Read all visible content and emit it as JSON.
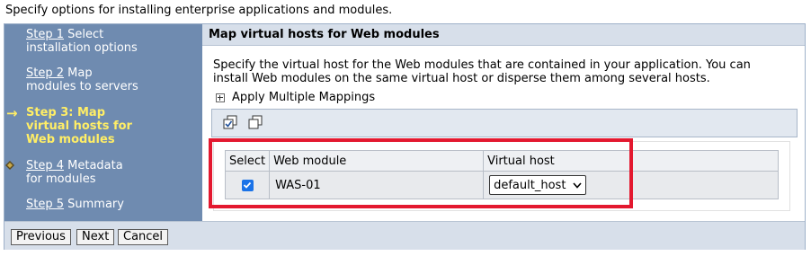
{
  "intro": "Specify options for installing enterprise applications and modules.",
  "steps": {
    "step1": {
      "link": "Step 1",
      "text": " Select",
      "line2": "installation options"
    },
    "step2": {
      "link": "Step 2",
      "text": " Map",
      "line2": "modules to servers"
    },
    "step3": {
      "line1": "Step 3: Map",
      "line2": "virtual hosts for",
      "line3": "Web modules"
    },
    "step4": {
      "link": "Step 4",
      "text": " Metadata",
      "line2": "for modules"
    },
    "step5": {
      "link": "Step 5",
      "text": " Summary"
    }
  },
  "content": {
    "title": "Map virtual hosts for Web modules",
    "description": "Specify the virtual host for the Web modules that are contained in your application. You can install Web modules on the same virtual host or disperse them among several hosts.",
    "apply_label": "Apply Multiple Mappings"
  },
  "table": {
    "headers": [
      "Select",
      "Web module",
      "Virtual host"
    ],
    "rows": [
      {
        "selected": true,
        "web_module": "WAS-01",
        "virtual_host": "default_host"
      }
    ]
  },
  "buttons": {
    "previous": "Previous",
    "next": "Next",
    "cancel": "Cancel"
  },
  "colors": {
    "nav_bg": "#6f8bb0",
    "current_step": "#ffee66",
    "highlight": "#e3182f",
    "checkbox": "#1a73e8"
  }
}
